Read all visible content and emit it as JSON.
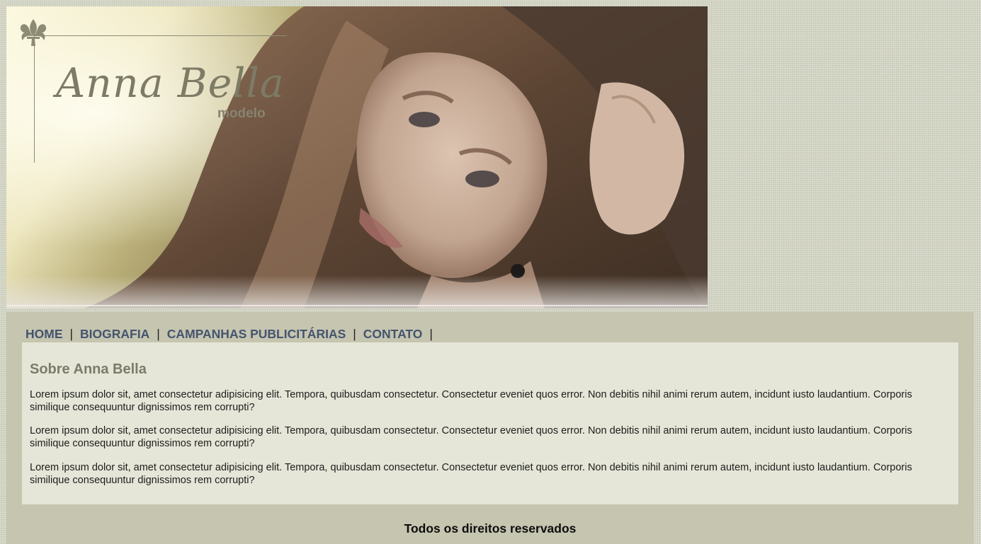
{
  "banner": {
    "logo_name": "Anna Bella",
    "logo_sub": "modelo"
  },
  "nav": {
    "items": [
      "HOME",
      "BIOGRAFIA",
      "CAMPANHAS PUBLICITÁRIAS",
      "CONTATO"
    ],
    "separator": "|"
  },
  "content": {
    "title": "Sobre Anna Bella",
    "paragraphs": [
      "Lorem ipsum dolor sit, amet consectetur adipisicing elit. Tempora, quibusdam consectetur. Consectetur eveniet quos error. Non debitis nihil animi rerum autem, incidunt iusto laudantium. Corporis similique consequuntur dignissimos rem corrupti?",
      "Lorem ipsum dolor sit, amet consectetur adipisicing elit. Tempora, quibusdam consectetur. Consectetur eveniet quos error. Non debitis nihil animi rerum autem, incidunt iusto laudantium. Corporis similique consequuntur dignissimos rem corrupti?",
      "Lorem ipsum dolor sit, amet consectetur adipisicing elit. Tempora, quibusdam consectetur. Consectetur eveniet quos error. Non debitis nihil animi rerum autem, incidunt iusto laudantium. Corporis similique consequuntur dignissimos rem corrupti?"
    ]
  },
  "footer": {
    "text": "Todos os direitos reservados"
  },
  "colors": {
    "page_background": "#d2d4c3",
    "panel_background": "#c5c5b0",
    "content_background": "#e5e6d7",
    "nav_link": "#45546e",
    "heading": "#7b7b69",
    "logo": "#7d7b66"
  }
}
